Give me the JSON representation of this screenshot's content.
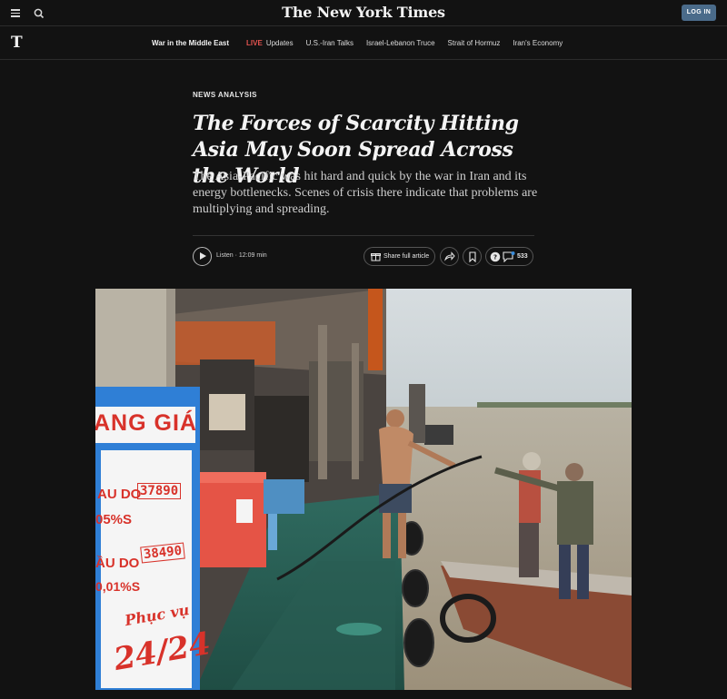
{
  "header": {
    "masthead": "The New York Times",
    "login_label": "LOG IN"
  },
  "nav": {
    "logo": "T",
    "title": "War in the Middle East",
    "live_tag": "LIVE",
    "items": [
      "Updates",
      "U.S.-Iran Talks",
      "Israel-Lebanon Truce",
      "Strait of Hormuz",
      "Iran's Economy"
    ]
  },
  "article": {
    "kicker": "NEWS ANALYSIS",
    "headline": "The Forces of Scarcity Hitting Asia May Soon Spread Across the World",
    "summary": "The Asia-Pacific was hit hard and quick by the war in Iran and its energy bottlenecks. Scenes of crisis there indicate that problems are multiplying and spreading.",
    "listen_label": "Listen · 12:09 min",
    "share_label": "Share full article",
    "comment_count": "533"
  },
  "photo": {
    "sign_header": "ANG GIÁ",
    "sign_line1_label": "AU DO",
    "sign_line1_price": "37890",
    "sign_line2_label": "05%S",
    "sign_line3_label": "ẦU DO",
    "sign_line3_price": "38490",
    "sign_line4_label": "0,01%S",
    "sign_footer_small": "Phục vụ",
    "sign_footer_big": "24/24"
  },
  "colors": {
    "background": "#121212",
    "login_button": "#4a6b8a",
    "live": "#e2534f",
    "sign_blue": "#2f7fd6",
    "sign_red": "#d8322a"
  }
}
